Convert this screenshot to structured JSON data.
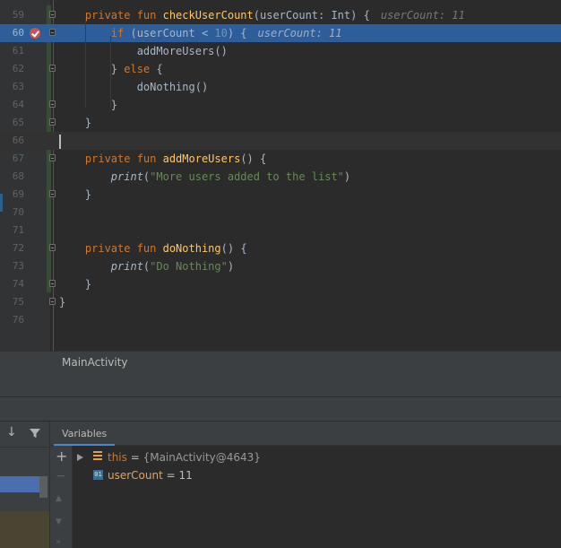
{
  "editor": {
    "lines": [
      {
        "num": "59",
        "segments": [
          {
            "t": "    "
          },
          {
            "t": "private fun ",
            "c": "kw"
          },
          {
            "t": "checkUserCount",
            "c": "fn"
          },
          {
            "t": "(userCount: Int) {"
          }
        ],
        "hint": "userCount: 11",
        "fold": true
      },
      {
        "num": "60",
        "segments": [
          {
            "t": "        "
          },
          {
            "t": "if ",
            "c": "kw"
          },
          {
            "t": "(userCount < "
          },
          {
            "t": "10",
            "c": "num"
          },
          {
            "t": ") {"
          }
        ],
        "hint": "userCount: 11",
        "fold": true,
        "breakpoint": true,
        "exec": true
      },
      {
        "num": "61",
        "segments": [
          {
            "t": "            addMoreUsers()"
          }
        ]
      },
      {
        "num": "62",
        "segments": [
          {
            "t": "        } "
          },
          {
            "t": "else",
            "c": "kw"
          },
          {
            "t": " {"
          }
        ],
        "fold": true
      },
      {
        "num": "63",
        "segments": [
          {
            "t": "            doNothing()"
          }
        ]
      },
      {
        "num": "64",
        "segments": [
          {
            "t": "        }"
          }
        ],
        "fold": true
      },
      {
        "num": "65",
        "segments": [
          {
            "t": "    }"
          }
        ],
        "fold": true
      },
      {
        "num": "66",
        "segments": [],
        "current": true
      },
      {
        "num": "67",
        "segments": [
          {
            "t": "    "
          },
          {
            "t": "private fun ",
            "c": "kw"
          },
          {
            "t": "addMoreUsers",
            "c": "fn"
          },
          {
            "t": "() {"
          }
        ],
        "fold": true
      },
      {
        "num": "68",
        "segments": [
          {
            "t": "        "
          },
          {
            "t": "print",
            "c": "it"
          },
          {
            "t": "("
          },
          {
            "t": "\"More users added to the list\"",
            "c": "str"
          },
          {
            "t": ")"
          }
        ]
      },
      {
        "num": "69",
        "segments": [
          {
            "t": "    }"
          }
        ],
        "fold": true
      },
      {
        "num": "70",
        "segments": []
      },
      {
        "num": "71",
        "segments": []
      },
      {
        "num": "72",
        "segments": [
          {
            "t": "    "
          },
          {
            "t": "private fun ",
            "c": "kw"
          },
          {
            "t": "doNothing",
            "c": "fn"
          },
          {
            "t": "() {"
          }
        ],
        "fold": true
      },
      {
        "num": "73",
        "segments": [
          {
            "t": "        "
          },
          {
            "t": "print",
            "c": "it"
          },
          {
            "t": "("
          },
          {
            "t": "\"Do Nothing\"",
            "c": "str"
          },
          {
            "t": ")"
          }
        ]
      },
      {
        "num": "74",
        "segments": [
          {
            "t": "    }"
          }
        ],
        "fold": true
      },
      {
        "num": "75",
        "segments": [
          {
            "t": "}"
          }
        ],
        "fold": true
      },
      {
        "num": "76",
        "segments": []
      }
    ]
  },
  "breadcrumb": {
    "label": "MainActivity"
  },
  "variables": {
    "tab_label": "Variables",
    "items": [
      {
        "name": "this",
        "equals": " = ",
        "value": "{MainActivity@4643}",
        "kind": "field",
        "expandable": true
      },
      {
        "name": "userCount",
        "equals": " = ",
        "value": "11",
        "kind": "local",
        "expandable": false,
        "icon_text": "01"
      }
    ]
  },
  "colors": {
    "keyword": "#cc7832",
    "function": "#ffc66d",
    "string": "#6a8759",
    "number": "#6897bb",
    "execution_line": "#2d5e9a",
    "breakpoint": "#c75450"
  }
}
